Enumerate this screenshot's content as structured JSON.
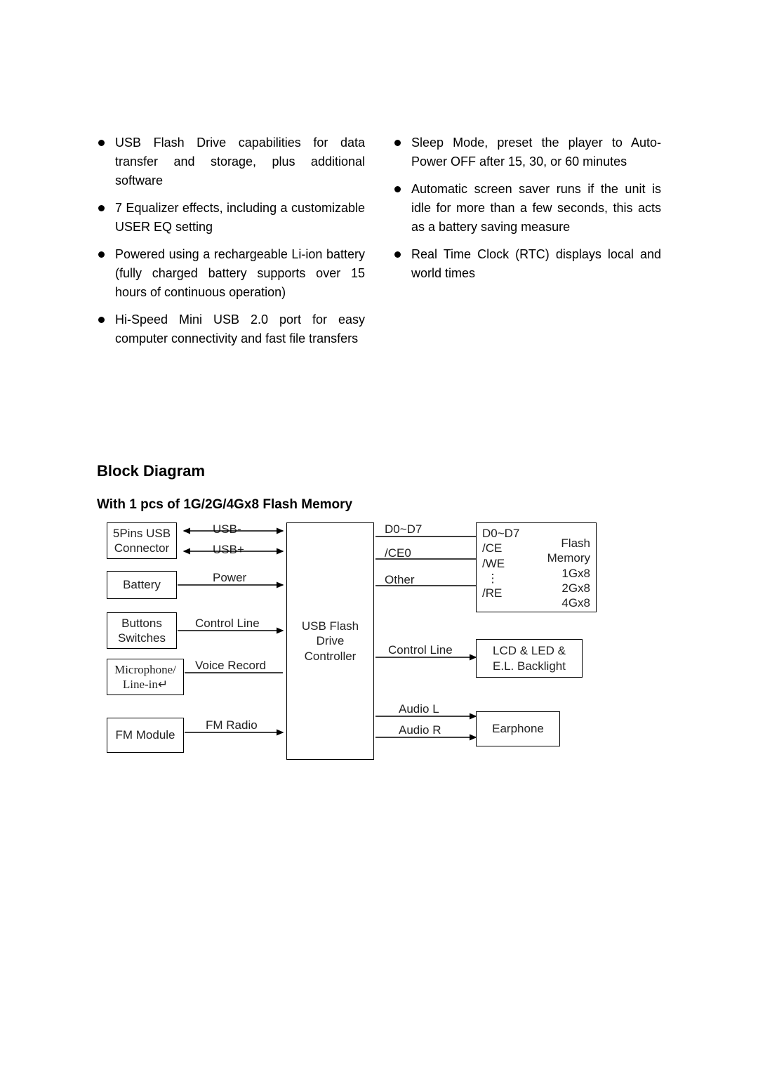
{
  "features_left": [
    "USB Flash Drive capabilities for data transfer and storage, plus additional software",
    "7 Equalizer effects, including a customizable USER EQ setting",
    "Powered using a rechargeable Li-ion battery (fully charged battery supports over 15 hours of continuous operation)",
    "Hi-Speed Mini USB 2.0 port for easy computer connectivity and fast file transfers"
  ],
  "features_right": [
    "Sleep Mode, preset the player to Auto-Power OFF after 15, 30, or 60 minutes",
    "Automatic screen saver runs if the unit is idle for more than a few seconds, this acts as a battery saving measure",
    "Real Time Clock (RTC) displays local and world times"
  ],
  "section_title": "Block Diagram",
  "subsection_title": "With 1 pcs of 1G/2G/4Gx8 Flash Memory",
  "diagram": {
    "boxes": {
      "usb_connector": {
        "line1": "5Pins USB",
        "line2": "Connector"
      },
      "battery": "Battery",
      "buttons": {
        "line1": "Buttons",
        "line2": "Switches"
      },
      "microphone": {
        "line1": "Microphone/",
        "line2": "Line-in↵"
      },
      "fm_module": "FM Module",
      "controller": {
        "line1": "USB Flash",
        "line2": "Drive",
        "line3": "Controller"
      },
      "flash_memory": {
        "d0d7": "D0~D7",
        "ce": "/CE",
        "we": "/WE",
        "dots": "⋮",
        "re": "/RE",
        "label1": "Flash",
        "label2": "Memory",
        "size1": "1Gx8",
        "size2": "2Gx8",
        "size3": "4Gx8"
      },
      "lcd": {
        "line1": "LCD & LED &",
        "line2": "E.L. Backlight"
      },
      "earphone": "Earphone"
    },
    "labels": {
      "usb_minus": "USB-",
      "usb_plus": "USB+",
      "power": "Power",
      "control_line_left": "Control Line",
      "voice_record": "Voice Record",
      "fm_radio": "FM Radio",
      "d0d7_right": "D0~D7",
      "ce0": "/CE0",
      "other": "Other",
      "control_line_right": "Control Line",
      "audio_l": "Audio L",
      "audio_r": "Audio R"
    }
  }
}
